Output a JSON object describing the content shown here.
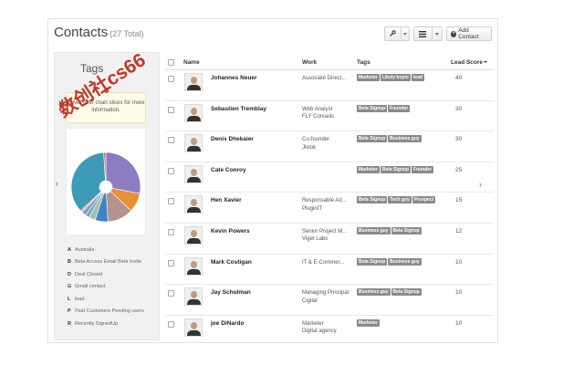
{
  "header": {
    "title": "Contacts",
    "count": "(27 Total)",
    "add_contact_label": "Add Contact"
  },
  "sidebar": {
    "title": "Tags",
    "hover_hint": "Hover over chart slices for more information.",
    "prev_arrow": "‹",
    "next_arrow": "›",
    "legend": [
      {
        "key": "A",
        "label": "Australia"
      },
      {
        "key": "B",
        "label": "Beta Access Email Beta Invite"
      },
      {
        "key": "D",
        "label": "Deal Closed"
      },
      {
        "key": "G",
        "label": "Gmail contact"
      },
      {
        "key": "L",
        "label": "lead"
      },
      {
        "key": "P",
        "label": "Paid Customers Pending users"
      },
      {
        "key": "R",
        "label": "Recently SignedUp"
      }
    ]
  },
  "chart_data": {
    "type": "pie",
    "donut": true,
    "title": "",
    "legend_position": "bottom",
    "colors": [
      "#8e7cc3",
      "#e69138",
      "#b4928d",
      "#3d85c6",
      "#a4c2a5",
      "#6fa8dc",
      "#999999",
      "#d8a5c6",
      "#3d9bb5",
      "#e06666"
    ],
    "values": [
      28,
      9,
      12,
      6,
      3,
      2,
      2,
      1,
      36,
      1
    ]
  },
  "table": {
    "headers": {
      "name": "Name",
      "work": "Work",
      "tags": "Tags",
      "score": "Lead Score"
    },
    "rows": [
      {
        "name": "Johannes Neuer",
        "work": [
          "Associate Direct..."
        ],
        "tags": [
          "Marketer",
          "Likely buyer",
          "lead"
        ],
        "score": "40"
      },
      {
        "name": "Sebastien Tremblay",
        "work": [
          "Web Analyst",
          "FLY Conseils"
        ],
        "tags": [
          "Beta Signup",
          "Founder"
        ],
        "score": "30"
      },
      {
        "name": "Denis Dhekaier",
        "work": [
          "Co-founder",
          "Jiwok"
        ],
        "tags": [
          "Beta Signup",
          "Business guy"
        ],
        "score": "30"
      },
      {
        "name": "Cate Conroy",
        "work": [],
        "tags": [
          "Marketer",
          "Beta Signup",
          "Founder"
        ],
        "score": "25"
      },
      {
        "name": "Hen Xavier",
        "work": [
          "Responsable Ad...",
          "PluginIT"
        ],
        "tags": [
          "Beta Signup",
          "Tech guy",
          "Prospect"
        ],
        "score": "15"
      },
      {
        "name": "Kevin Powers",
        "work": [
          "Senior Project M...",
          "Viget Labs"
        ],
        "tags": [
          "Business guy",
          "Beta Signup"
        ],
        "score": "12"
      },
      {
        "name": "Mark Costigan",
        "work": [
          "IT & E-Commer..."
        ],
        "tags": [
          "Beta Signup",
          "Business guy"
        ],
        "score": "10"
      },
      {
        "name": "Jay Schulman",
        "work": [
          "Managing Principal",
          "Cigital"
        ],
        "tags": [
          "Business guy",
          "Beta Signup"
        ],
        "score": "10"
      },
      {
        "name": "joe DiNardo",
        "work": [
          "Marketer",
          "Digital agency"
        ],
        "tags": [
          "Marketer"
        ],
        "score": "10"
      }
    ]
  },
  "watermark": {
    "text": "数创社cs66",
    "color": "#c0392b"
  },
  "icons": {
    "tools": "wrench-icon",
    "view": "list-icon",
    "add": "plus-circle-icon"
  }
}
